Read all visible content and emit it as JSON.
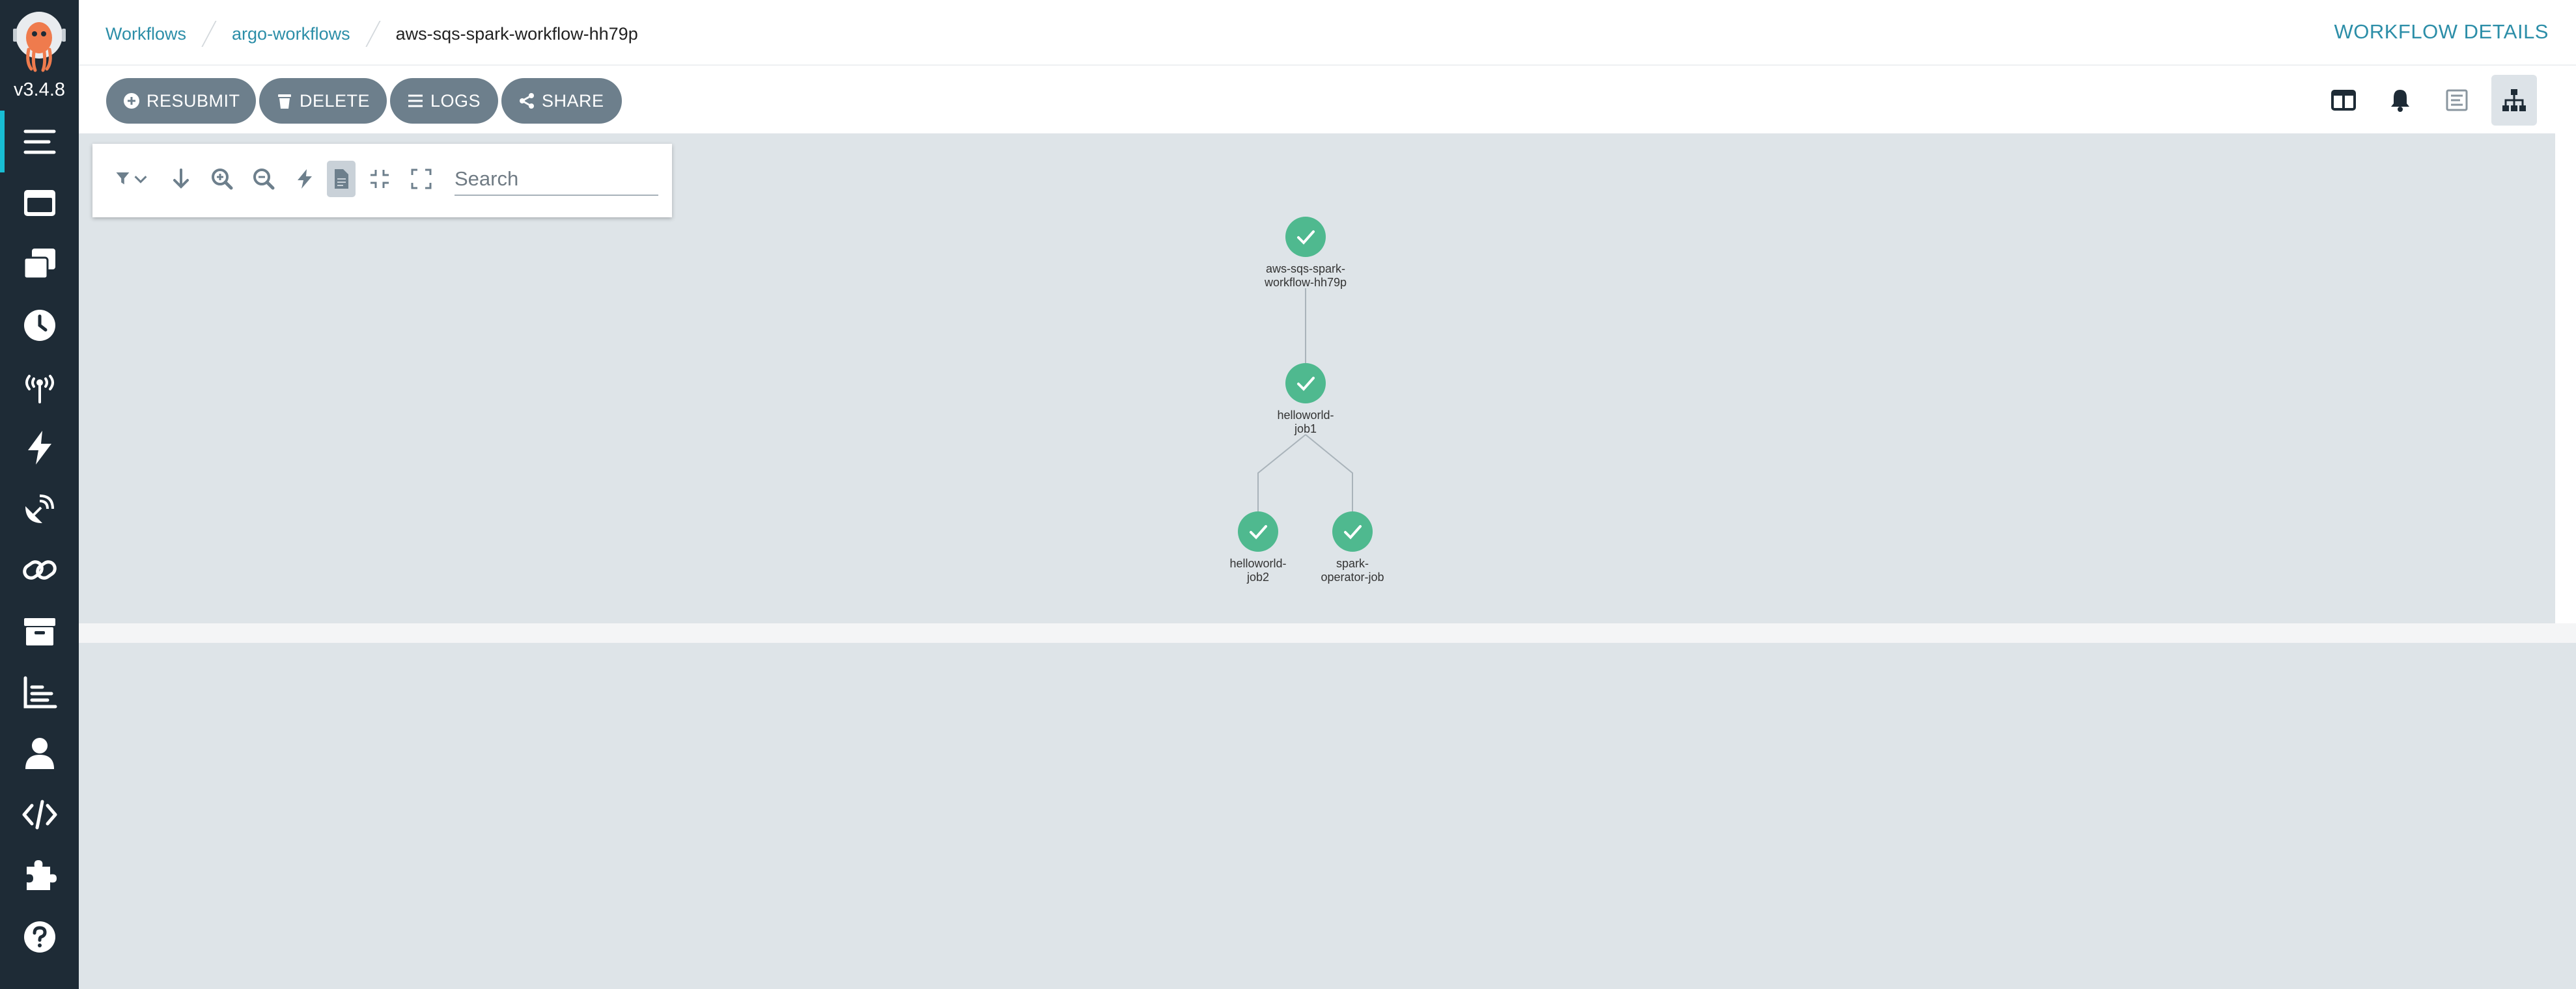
{
  "app": {
    "version": "v3.4.8",
    "logo_icon": "argo-octopus-logo"
  },
  "sidebar": {
    "items": [
      {
        "name": "workflows",
        "icon": "list-icon",
        "active": true
      },
      {
        "name": "workflow-templates",
        "icon": "window-icon",
        "active": false
      },
      {
        "name": "cluster-workflow-templates",
        "icon": "clone-icon",
        "active": false
      },
      {
        "name": "cron-workflows",
        "icon": "clock-icon",
        "active": false
      },
      {
        "name": "event-sources",
        "icon": "broadcast-tower-icon",
        "active": false
      },
      {
        "name": "sensors",
        "icon": "bolt-icon",
        "active": false
      },
      {
        "name": "event-flow",
        "icon": "satellite-dish-icon",
        "active": false
      },
      {
        "name": "workflow-event-bindings",
        "icon": "link-icon",
        "active": false
      },
      {
        "name": "archived-workflows",
        "icon": "archive-icon",
        "active": false
      },
      {
        "name": "reports",
        "icon": "chart-bar-icon",
        "active": false
      },
      {
        "name": "user",
        "icon": "user-icon",
        "active": false
      },
      {
        "name": "api-docs",
        "icon": "code-icon",
        "active": false
      },
      {
        "name": "plugins",
        "icon": "puzzle-piece-icon",
        "active": false
      },
      {
        "name": "help",
        "icon": "question-circle-icon",
        "active": false
      }
    ]
  },
  "header": {
    "breadcrumb": [
      "Workflows",
      "argo-workflows",
      "aws-sqs-spark-workflow-hh79p"
    ],
    "title": "WORKFLOW DETAILS"
  },
  "toolbar": {
    "resubmit_label": "RESUBMIT",
    "delete_label": "DELETE",
    "logs_label": "LOGS",
    "share_label": "SHARE",
    "views": [
      "summary-panel-icon",
      "events-bell-icon",
      "timeline-icon",
      "graph-sitemap-icon"
    ],
    "active_view": "graph-sitemap-icon"
  },
  "graph_toolbar": {
    "icons": [
      "filter-icon",
      "arrow-down-icon",
      "zoom-in-icon",
      "zoom-out-icon",
      "bolt-icon",
      "file-icon",
      "compress-icon",
      "expand-icon"
    ],
    "active_icon": "file-icon",
    "search_placeholder": "Search",
    "search_value": ""
  },
  "graph": {
    "nodes": [
      {
        "id": "root",
        "label_lines": [
          "aws-sqs-spark-",
          "workflow-hh79p"
        ],
        "status": "succeeded"
      },
      {
        "id": "job1",
        "label_lines": [
          "helloworld-",
          "job1"
        ],
        "status": "succeeded"
      },
      {
        "id": "job2",
        "label_lines": [
          "helloworld-",
          "job2"
        ],
        "status": "succeeded"
      },
      {
        "id": "spark",
        "label_lines": [
          "spark-",
          "operator-job"
        ],
        "status": "succeeded"
      }
    ],
    "edges": [
      [
        "root",
        "job1"
      ],
      [
        "job1",
        "job2"
      ],
      [
        "job1",
        "spark"
      ]
    ]
  },
  "colors": {
    "sidebar_bg": "#1e2b36",
    "accent": "#2c8ea8",
    "button_bg": "#6d7f8c",
    "success": "#4fb98f",
    "graph_bg": "#dee4e8"
  }
}
